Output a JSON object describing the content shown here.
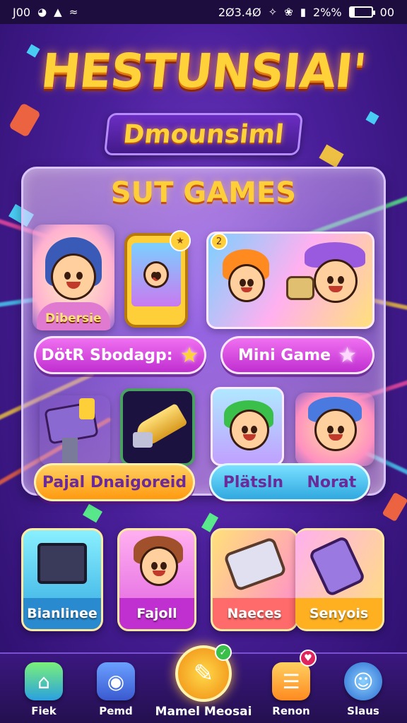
{
  "status_bar": {
    "time_left": "J00",
    "time_right": "2Ø3.4Ø",
    "battery_text": "2%%",
    "battery_tail": "00"
  },
  "header": {
    "title": "HESTUNSIAI'",
    "subtitle": "Dmounsiml"
  },
  "panel": {
    "title": "SUT GAMES",
    "character_label": "Dibersie",
    "button_left": "DötR Sbodagp:",
    "button_right": "Mini Game",
    "button_wide": "Pajal Dnaigoreid",
    "button_split_left": "Plätsln",
    "button_split_right": "Norat"
  },
  "bottom_cards": [
    {
      "label": "Bianlinee"
    },
    {
      "label": "Fajoll"
    },
    {
      "label": "Naeces"
    },
    {
      "label": "Senyois"
    }
  ],
  "nav": {
    "items": [
      {
        "label": "Fiek",
        "icon": "home-icon"
      },
      {
        "label": "Pemd",
        "icon": "camera-icon"
      },
      {
        "label": "Mamel Meosai",
        "icon": "chat-bubble-icon"
      },
      {
        "label": "Renon",
        "icon": "list-icon"
      },
      {
        "label": "Slaus",
        "icon": "profile-icon"
      }
    ]
  },
  "colors": {
    "accent_yellow": "#ffd23a",
    "pill_pink": "#d83ee0",
    "pill_orange": "#ffb020",
    "pill_blue": "#35b8e8"
  }
}
